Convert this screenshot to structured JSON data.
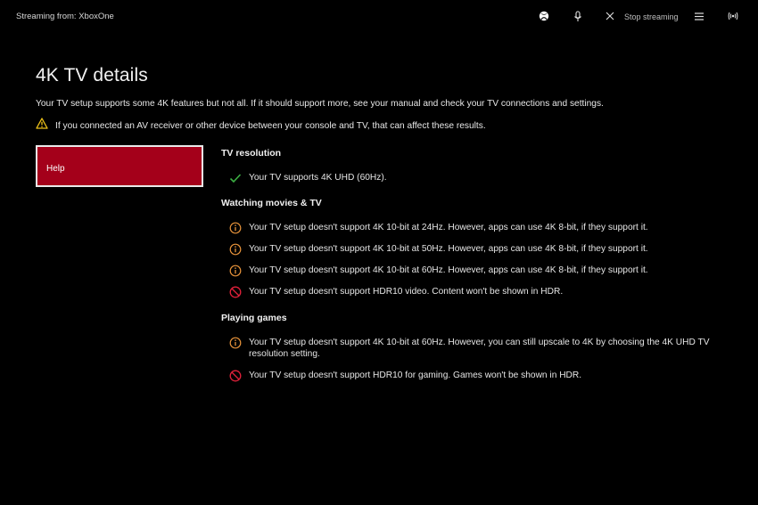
{
  "topbar": {
    "streaming_label": "Streaming from: XboxOne",
    "stop_label": "Stop streaming",
    "icons": [
      "xbox-icon",
      "microphone-icon",
      "close-icon",
      "menu-icon",
      "broadcast-icon"
    ]
  },
  "page": {
    "title": "4K TV details",
    "intro": "Your TV setup supports some 4K features but not all. If it should support more, see your manual and check your TV connections and settings.",
    "warning": "If you connected an AV receiver or other device between your console and TV, that can affect these results."
  },
  "help": {
    "label": "Help"
  },
  "sections": [
    {
      "title": "TV resolution",
      "items": [
        {
          "status": "ok",
          "text": "Your TV supports 4K UHD (60Hz)."
        }
      ]
    },
    {
      "title": "Watching movies & TV",
      "items": [
        {
          "status": "info",
          "text": "Your TV setup doesn't support 4K 10-bit at 24Hz. However, apps can use 4K 8-bit, if they support it."
        },
        {
          "status": "info",
          "text": "Your TV setup doesn't support 4K 10-bit at 50Hz. However, apps can use 4K 8-bit, if they support it."
        },
        {
          "status": "info",
          "text": "Your TV setup doesn't support 4K 10-bit at 60Hz. However, apps can use 4K 8-bit, if they support it."
        },
        {
          "status": "blocked",
          "text": "Your TV setup doesn't support HDR10 video. Content won't be shown in HDR."
        }
      ]
    },
    {
      "title": "Playing games",
      "items": [
        {
          "status": "info",
          "text": "Your TV setup doesn't support 4K 10-bit at 60Hz. However, you can still upscale to 4K by choosing the 4K UHD TV resolution setting."
        },
        {
          "status": "blocked",
          "text": "Your TV setup doesn't support HDR10 for gaming. Games won't be shown in HDR."
        }
      ]
    }
  ],
  "colors": {
    "background": "#000000",
    "help_button": "#a4001a",
    "ok": "#3cb043",
    "info": "#e8933a",
    "blocked": "#e0203a",
    "warning": "#f0c419"
  }
}
